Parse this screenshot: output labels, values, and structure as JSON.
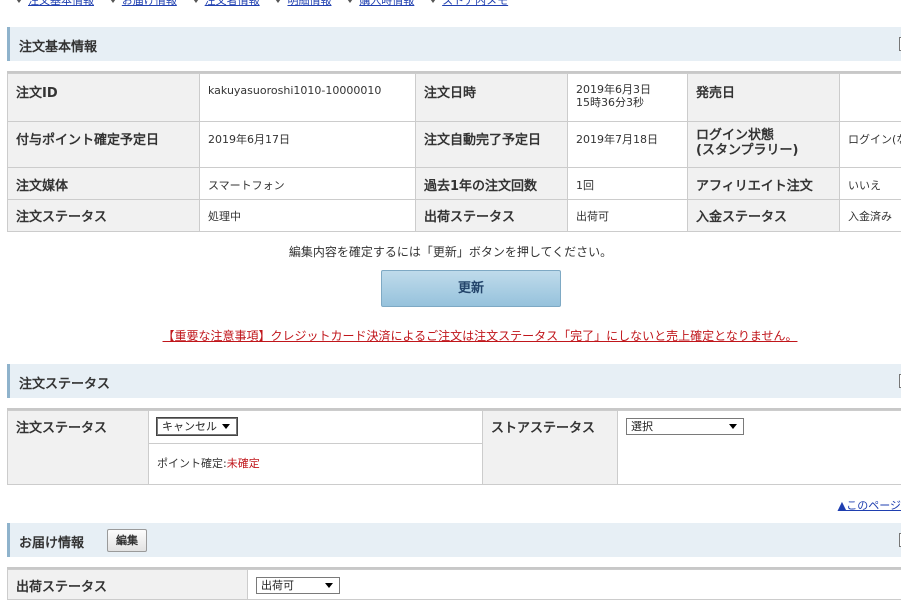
{
  "topnav": {
    "links": [
      "注文基本情報",
      "お届け情報",
      "注文者情報",
      "明細情報",
      "購入時情報",
      "ストア内メモ"
    ]
  },
  "basic_section": {
    "title": "注文基本情報",
    "rows": [
      [
        {
          "label": "注文ID",
          "value": "kakuyasuoroshi1010-10000010"
        },
        {
          "label": "注文日時",
          "value": "2019年6月3日",
          "value2": "15時36分3秒"
        },
        {
          "label": "発売日",
          "value": ""
        }
      ],
      [
        {
          "label": "付与ポイント確定予定日",
          "value": "2019年6月17日"
        },
        {
          "label": "注文自動完了予定日",
          "value": "2019年7月18日"
        },
        {
          "label": "ログイン状態",
          "label2": "(スタンプラリー)",
          "value": "ログイン(な"
        }
      ],
      [
        {
          "label": "注文媒体",
          "value": "スマートフォン"
        },
        {
          "label": "過去1年の注文回数",
          "value": "1回"
        },
        {
          "label": "アフィリエイト注文",
          "value": "いいえ"
        }
      ],
      [
        {
          "label": "注文ステータス",
          "value": "処理中"
        },
        {
          "label": "出荷ステータス",
          "value": "出荷可"
        },
        {
          "label": "入金ステータス",
          "value": "入金済み"
        }
      ]
    ]
  },
  "update": {
    "notice": "編集内容を確定するには「更新」ボタンを押してください。",
    "button_label": "更新",
    "warning": "【重要な注意事項】クレジットカード決済によるご注文は注文ステータス「完了」にしないと売上確定となりません。"
  },
  "status_section": {
    "title": "注文ステータス",
    "order_status_label": "注文ステータス",
    "order_status_selected": "キャンセル",
    "point_label": "ポイント確定:",
    "point_value": "未確定",
    "store_status_label": "ストアステータス",
    "store_status_selected": "選択"
  },
  "page_top_link": "▲このページ",
  "delivery_section": {
    "title": "お届け情報",
    "edit_label": "編集",
    "ship_status_label": "出荷ステータス",
    "ship_status_selected": "出荷可"
  },
  "colors": {
    "link": "#1f3fb0",
    "warning_red": "#c0161b",
    "header_bg": "#e7eff5",
    "button_bg": "#96c2dc"
  }
}
